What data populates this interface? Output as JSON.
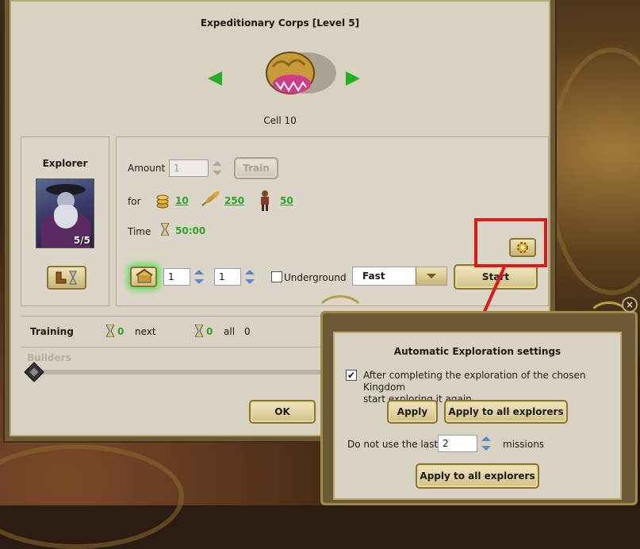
{
  "dialog": {
    "title": "Expeditionary Corps [Level 5]",
    "cell": "Cell 10",
    "ok_label": "OK"
  },
  "explorer": {
    "title": "Explorer",
    "count": "5/5"
  },
  "train": {
    "amount_label": "Amount",
    "amount_value": "1",
    "train_label": "Train",
    "for_label": "for",
    "cost_gold": "10",
    "cost_wheat": "250",
    "cost_iron": "50",
    "time_label": "Time",
    "time_value": "50:00"
  },
  "expedition": {
    "spin1": "1",
    "spin2": "1",
    "underground_label": "Underground",
    "speed_selected": "Fast",
    "start_label": "Start"
  },
  "training": {
    "label": "Training",
    "count": "0",
    "next_label": "next",
    "all_count": "0",
    "all_label": "all",
    "all_value": "0"
  },
  "builders": {
    "label": "Builders"
  },
  "popup": {
    "title": "Automatic Exploration settings",
    "repeat_text_line1": "After completing the exploration of the chosen Kingdom",
    "repeat_text_line2": "start exploring it again",
    "repeat_checked": true,
    "apply_label": "Apply",
    "apply_all_label": "Apply to all explorers",
    "do_not_use_label": "Do not use the last",
    "missions_value": "2",
    "missions_label": "missions",
    "apply_all_label_2": "Apply to all explorers",
    "close_label": "×"
  },
  "colors": {
    "accent_green": "#2aa42a",
    "highlight_red": "#e01919",
    "panel_bg": "#d8d2c2",
    "frame_gold": "#b9a86e"
  },
  "icons": [
    "arrow-left-icon",
    "arrow-right-icon",
    "gold-coins-icon",
    "wheat-icon",
    "iron-figure-icon",
    "hourglass-icon",
    "gear-icon",
    "home-icon",
    "boots-hourglass-icon",
    "close-icon",
    "chevron-down-icon"
  ]
}
